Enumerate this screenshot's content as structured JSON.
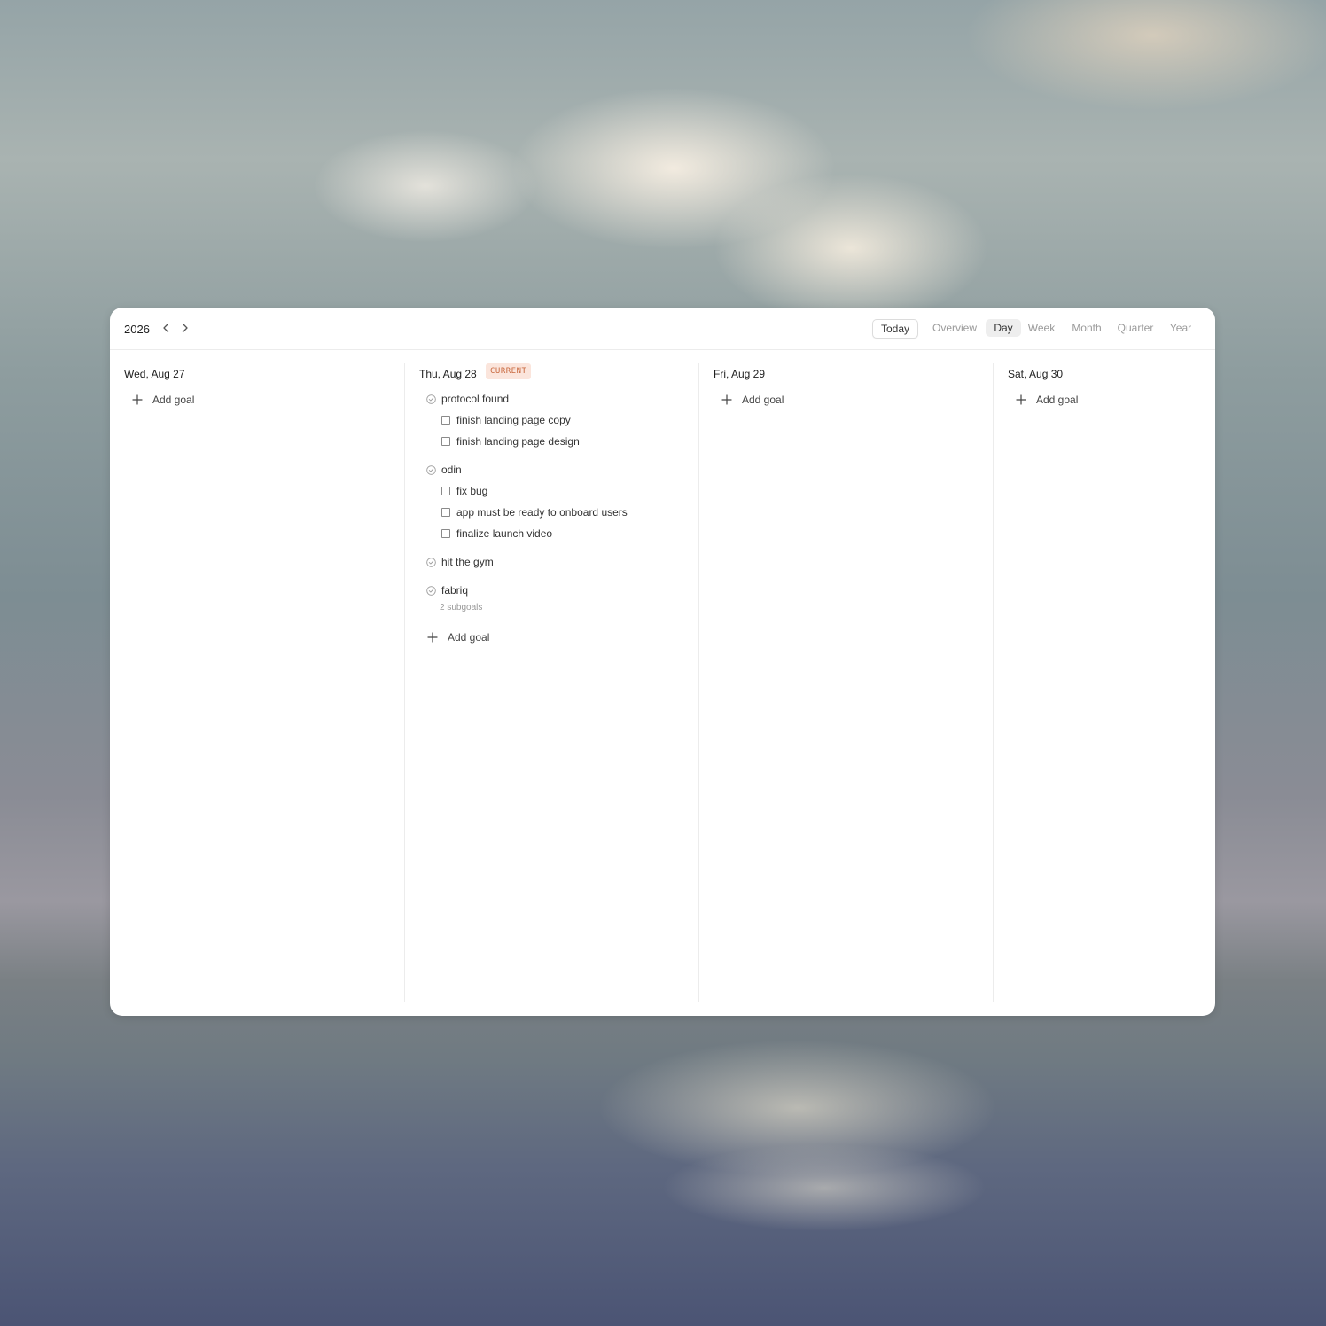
{
  "header": {
    "year": "2026",
    "today_label": "Today",
    "views": [
      {
        "label": "Overview",
        "active": false
      },
      {
        "label": "Day",
        "active": true
      },
      {
        "label": "Week",
        "active": false
      },
      {
        "label": "Month",
        "active": false
      },
      {
        "label": "Quarter",
        "active": false
      },
      {
        "label": "Year",
        "active": false
      }
    ]
  },
  "days": [
    {
      "title": "Wed, Aug 27",
      "add_goal_label": "Add goal"
    },
    {
      "title": "Thu, Aug 28",
      "badge": "CURRENT",
      "goals": [
        {
          "label": "protocol found",
          "tasks": [
            "finish landing page copy",
            "finish landing page design"
          ]
        },
        {
          "label": "odin",
          "tasks": [
            "fix bug",
            "app must be ready to onboard users",
            "finalize launch video"
          ]
        },
        {
          "label": "hit the gym",
          "tasks": []
        },
        {
          "label": "fabriq",
          "subgoals_note": "2 subgoals"
        }
      ],
      "add_goal_label": "Add goal"
    },
    {
      "title": "Fri, Aug 29",
      "add_goal_label": "Add goal"
    },
    {
      "title": "Sat, Aug 30",
      "add_goal_label": "Add goal"
    }
  ],
  "colors": {
    "current_badge_bg": "#fbe5dc",
    "current_badge_text": "#c8683e",
    "active_tab_bg": "#eeeeee"
  },
  "icons": {
    "prev": "chevron-left-icon",
    "next": "chevron-right-icon",
    "add": "plus-icon",
    "goal": "circle-check-icon",
    "task": "checkbox-icon"
  }
}
